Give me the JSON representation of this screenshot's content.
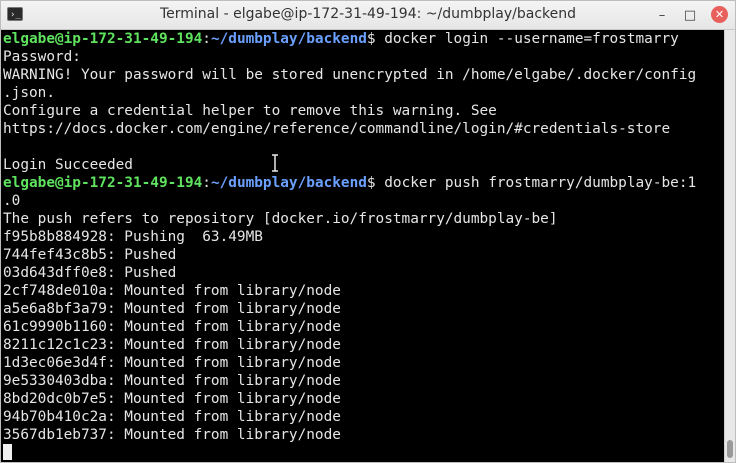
{
  "window": {
    "title": "Terminal - elgabe@ip-172-31-49-194: ~/dumbplay/backend",
    "icon": "terminal-icon",
    "controls": {
      "minimize": "–",
      "maximize": "□",
      "close": "✕"
    }
  },
  "prompt": {
    "user_host": "elgabe@ip-172-31-49-194",
    "separator": ":",
    "path": "~/dumbplay/backend",
    "symbol": "$"
  },
  "lines": [
    {
      "type": "prompt",
      "command": " docker login --username=frostmarry"
    },
    {
      "type": "text",
      "text": "Password:"
    },
    {
      "type": "text",
      "text": "WARNING! Your password will be stored unencrypted in /home/elgabe/.docker/config"
    },
    {
      "type": "text",
      "text": ".json."
    },
    {
      "type": "text",
      "text": "Configure a credential helper to remove this warning. See"
    },
    {
      "type": "text",
      "text": "https://docs.docker.com/engine/reference/commandline/login/#credentials-store"
    },
    {
      "type": "text",
      "text": ""
    },
    {
      "type": "text",
      "text": "Login Succeeded"
    },
    {
      "type": "prompt",
      "command": " docker push frostmarry/dumbplay-be:1"
    },
    {
      "type": "text",
      "text": ".0"
    },
    {
      "type": "text",
      "text": "The push refers to repository [docker.io/frostmarry/dumbplay-be]"
    },
    {
      "type": "text",
      "text": "f95b8b884928: Pushing  63.49MB"
    },
    {
      "type": "text",
      "text": "744fef43c8b5: Pushed"
    },
    {
      "type": "text",
      "text": "03d643dff0e8: Pushed"
    },
    {
      "type": "text",
      "text": "2cf748de010a: Mounted from library/node"
    },
    {
      "type": "text",
      "text": "a5e6a8bf3a79: Mounted from library/node"
    },
    {
      "type": "text",
      "text": "61c9990b1160: Mounted from library/node"
    },
    {
      "type": "text",
      "text": "8211c12c1c23: Mounted from library/node"
    },
    {
      "type": "text",
      "text": "1d3ec06e3d4f: Mounted from library/node"
    },
    {
      "type": "text",
      "text": "9e5330403dba: Mounted from library/node"
    },
    {
      "type": "text",
      "text": "8bd20dc0b7e5: Mounted from library/node"
    },
    {
      "type": "text",
      "text": "94b70b410c2a: Mounted from library/node"
    },
    {
      "type": "text",
      "text": "3567db1eb737: Mounted from library/node"
    },
    {
      "type": "cursor"
    }
  ],
  "colors": {
    "background": "#000000",
    "foreground": "#e6e6e6",
    "user_host": "#5fe35f",
    "path": "#6aa0ff",
    "close_button": "#e8605b"
  }
}
